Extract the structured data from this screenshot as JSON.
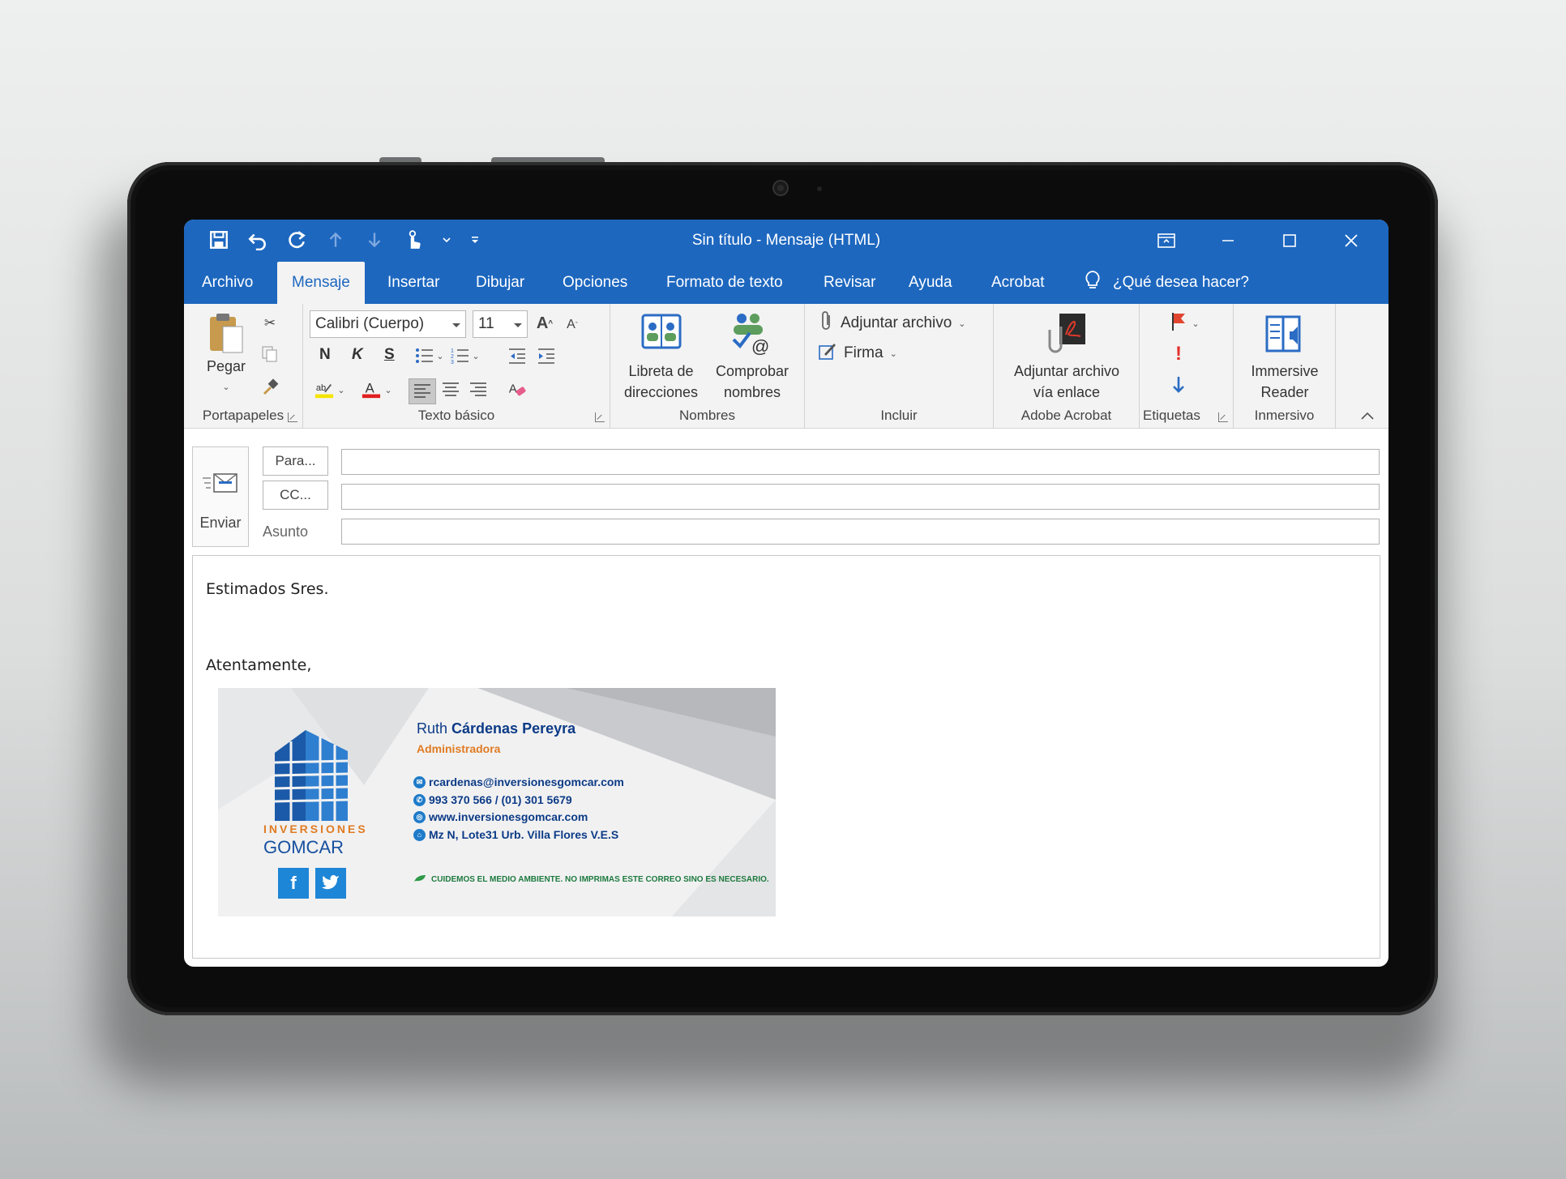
{
  "window": {
    "title": "Sin título  -  Mensaje (HTML)"
  },
  "tabs": [
    {
      "label": "Archivo"
    },
    {
      "label": "Mensaje"
    },
    {
      "label": "Insertar"
    },
    {
      "label": "Dibujar"
    },
    {
      "label": "Opciones"
    },
    {
      "label": "Formato de texto"
    },
    {
      "label": "Revisar"
    },
    {
      "label": "Ayuda"
    },
    {
      "label": "Acrobat"
    }
  ],
  "active_tab": "Mensaje",
  "tell_me": "¿Qué desea hacer?",
  "ribbon": {
    "clipboard": {
      "paste_label": "Pegar",
      "group_label": "Portapapeles"
    },
    "basic_text": {
      "font_name": "Calibri (Cuerpo)",
      "font_size": "11",
      "bold": "N",
      "italic": "K",
      "underline": "S",
      "group_label": "Texto básico"
    },
    "names": {
      "address_book_line1": "Libreta de",
      "address_book_line2": "direcciones",
      "check_names_line1": "Comprobar",
      "check_names_line2": "nombres",
      "group_label": "Nombres"
    },
    "include": {
      "attach_file": "Adjuntar archivo",
      "signature": "Firma",
      "group_label": "Incluir"
    },
    "acrobat": {
      "attach_link_line1": "Adjuntar archivo",
      "attach_link_line2": "vía enlace",
      "group_label": "Adobe Acrobat"
    },
    "tags": {
      "group_label": "Etiquetas"
    },
    "immersive": {
      "reader_line1": "Immersive",
      "reader_line2": "Reader",
      "group_label": "Inmersivo"
    }
  },
  "compose": {
    "send_label": "Enviar",
    "to_button": "Para...",
    "cc_button": "CC...",
    "subject_label": "Asunto",
    "to_value": "",
    "cc_value": "",
    "subject_value": ""
  },
  "body": {
    "greeting": "Estimados Sres.",
    "closing": "Atentamente,"
  },
  "signature": {
    "first_name": "Ruth ",
    "last_name": "Cárdenas Pereyra",
    "role": "Administradora",
    "email": "rcardenas@inversionesgomcar.com",
    "phone": "993 370 566  /  (01) 301 5679",
    "website": "www.inversionesgomcar.com",
    "address": "Mz N, Lote31 Urb. Villa Flores V.E.S",
    "eco_note": "CUIDEMOS EL MEDIO AMBIENTE. NO IMPRIMAS ESTE CORREO SINO ES NECESARIO.",
    "logo_line1": "INVERSIONES",
    "logo_line2": "GOMCAR",
    "social": [
      "f",
      "t"
    ]
  },
  "colors": {
    "accent": "#1d67bf",
    "brand_blue": "#17509f",
    "brand_orange": "#e07b22"
  }
}
